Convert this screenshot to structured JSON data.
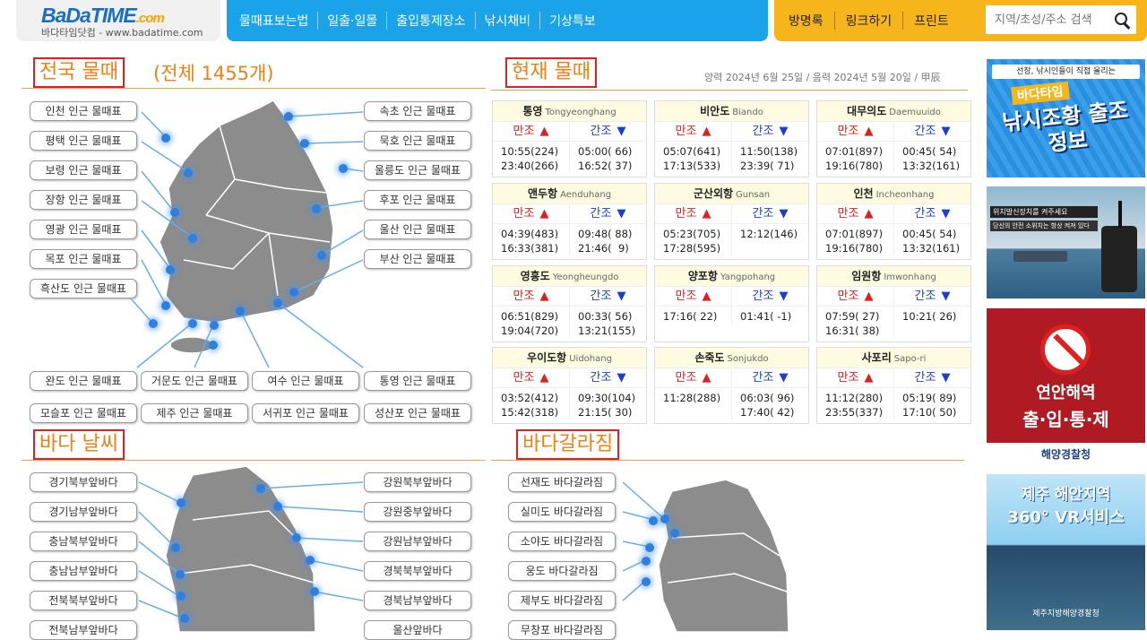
{
  "header": {
    "logo_main": "BaDa",
    "logo_accent": "TIME",
    "logo_dom": ".com",
    "logo_sub": "바다타임닷컴 - www.badatime.com",
    "nav": [
      "물때표보는법",
      "일출·일몰",
      "출입통제장소",
      "낚시채비",
      "기상특보"
    ],
    "util": [
      "방명록",
      "링크하기",
      "프린트"
    ],
    "search_placeholder": "지역/초성/주소 검색"
  },
  "tide_section": {
    "title": "전국 물때",
    "count": "(전체 1455개)",
    "left_buttons": [
      "인천 인근 물때표",
      "평택 인근 물때표",
      "보령 인근 물때표",
      "장항 인근 물때표",
      "영광 인근 물때표",
      "목포 인근 물때표",
      "흑산도 인근 물때표"
    ],
    "right_buttons": [
      "속초 인근 물때표",
      "묵호 인근 물때표",
      "울릉도 인근 물때표",
      "후포 인근 물때표",
      "울산 인근 물때표",
      "부산 인근 물때표"
    ],
    "bottom_row1": [
      "완도 인근 물때표",
      "거문도 인근 물때표",
      "여수 인근 물때표",
      "통영 인근 물때표"
    ],
    "bottom_row2": [
      "모슬포 인근 물때표",
      "제주 인근 물때표",
      "서귀포 인근 물때표",
      "성산포 인근 물때표"
    ]
  },
  "current": {
    "title": "현재 물때",
    "date": "양력 2024년 6월 25일 / 음력 2024년 5월 20일 / 甲辰",
    "high_label": "만조",
    "low_label": "간조",
    "ports": [
      {
        "name": "통영",
        "en": "Tongyeonghang",
        "high": "10:55(224)\n23:40(266)",
        "low": "05:00( 66)\n16:52( 37)"
      },
      {
        "name": "비안도",
        "en": "Biando",
        "high": "05:07(641)\n17:13(533)",
        "low": "11:50(138)\n23:39( 71)"
      },
      {
        "name": "대무의도",
        "en": "Daemuuido",
        "high": "07:01(897)\n19:16(780)",
        "low": "00:45( 54)\n13:32(161)"
      },
      {
        "name": "앤두항",
        "en": "Aenduhang",
        "high": "04:39(483)\n16:33(381)",
        "low": "09:48( 88)\n21:46(  9)"
      },
      {
        "name": "군산외항",
        "en": "Gunsan",
        "high": "05:23(705)\n17:28(595)",
        "low": "12:12(146)"
      },
      {
        "name": "인천",
        "en": "Incheonhang",
        "high": "07:01(897)\n19:16(780)",
        "low": "00:45( 54)\n13:32(161)"
      },
      {
        "name": "영흥도",
        "en": "Yeongheungdo",
        "high": "06:51(829)\n19:04(720)",
        "low": "00:33( 56)\n13:21(155)"
      },
      {
        "name": "양포항",
        "en": "Yangpohang",
        "high": "17:16( 22)",
        "low": "01:41( -1)"
      },
      {
        "name": "임원항",
        "en": "Imwonhang",
        "high": "07:59( 27)\n16:31( 38)",
        "low": "10:21( 26)"
      },
      {
        "name": "우이도항",
        "en": "Uidohang",
        "high": "03:52(412)\n15:42(318)",
        "low": "09:30(104)\n21:15( 30)"
      },
      {
        "name": "손죽도",
        "en": "Sonjukdo",
        "high": "11:28(288)",
        "low": "06:03( 96)\n17:40( 42)"
      },
      {
        "name": "사포리",
        "en": "Sapo-ri",
        "high": "11:12(280)\n23:55(337)",
        "low": "05:19( 89)\n17:10( 50)"
      }
    ]
  },
  "weather": {
    "title": "바다 날씨",
    "left": [
      "경기북부앞바다",
      "경기남부앞바다",
      "충남북부앞바다",
      "충남남부앞바다",
      "전북북부앞바다",
      "전북남부앞바다"
    ],
    "right": [
      "강원북부앞바다",
      "강원중부앞바다",
      "강원남부앞바다",
      "경북북부앞바다",
      "경북남부앞바다",
      "울산앞바다"
    ]
  },
  "parting": {
    "title": "바다갈라짐",
    "items": [
      "선재도 바다갈라짐",
      "실미도 바다갈라짐",
      "소야도 바다갈라짐",
      "웅도 바다갈라짐",
      "제부도 바다갈라짐",
      "무창포 바다갈라짐"
    ]
  },
  "ads": {
    "a1_top": "선장, 낚시인들이 직접 올리는",
    "a1_brand": "바다타임",
    "a1_main": "낚시조황 출조정보",
    "a2_title": "위치발신장치를 켜주세요",
    "a2_sub": "당신의 안전 소위치는 항상 켜져 있다",
    "a3_l1": "연안해역",
    "a3_l2": "출·입·통·제",
    "a3_org": "해양경찰청",
    "a4_l1": "제주 해안지역",
    "a4_l2": "360° VR서비스",
    "a4_org": "제주지방해양경찰청"
  },
  "colors": {
    "nav": "#1aa3e8",
    "util": "#f7b51c",
    "accent": "#f08014",
    "box": "#e0201e",
    "high": "#e02020",
    "low": "#1a3fd0",
    "map": "#8c8c8c"
  }
}
